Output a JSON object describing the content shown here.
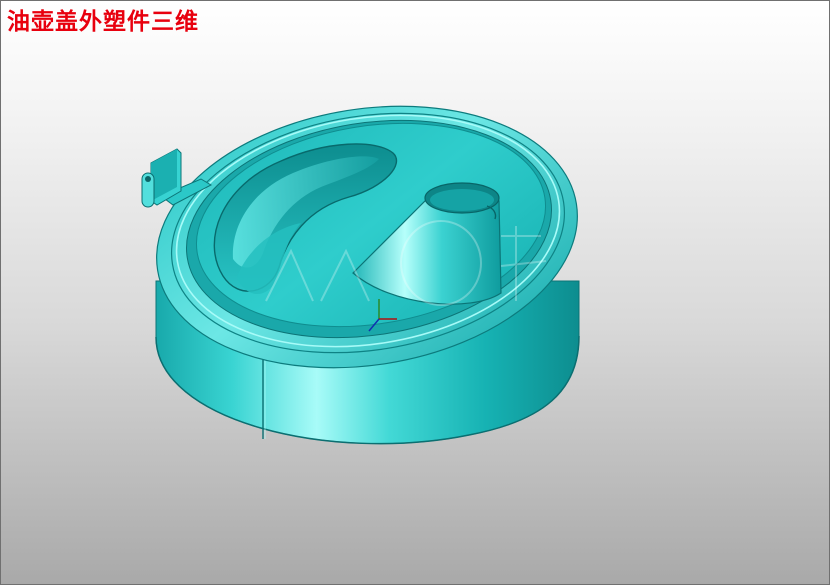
{
  "title": "油壶盖外塑件三维",
  "colors": {
    "part_base": "#17b9bb",
    "part_light": "#8ef2f1",
    "part_shadow": "#0a7f81",
    "title": "#e8000e"
  },
  "icons": [
    "triad-icon",
    "watermark-logo"
  ]
}
